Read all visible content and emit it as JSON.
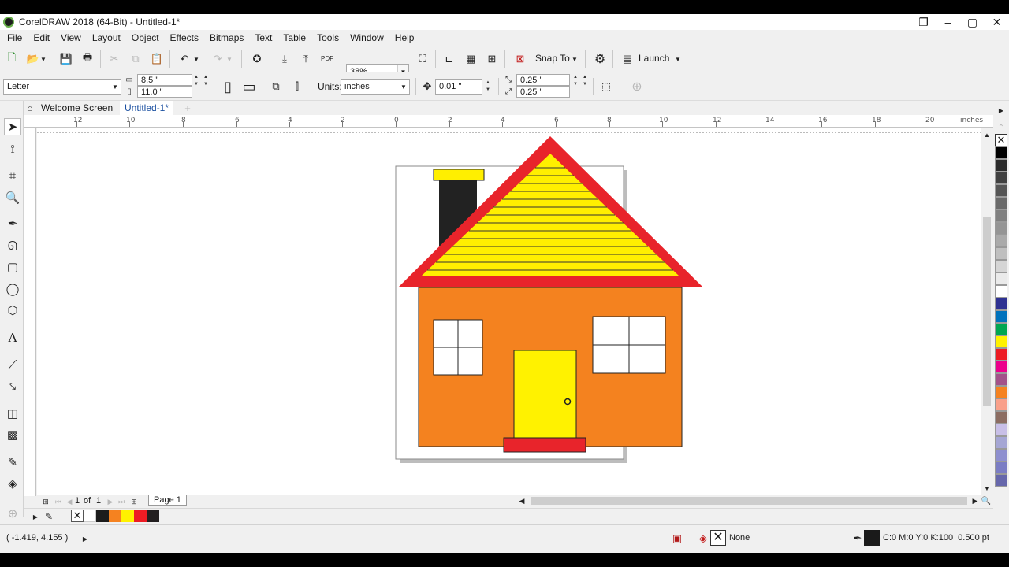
{
  "window": {
    "title": "CorelDRAW 2018 (64-Bit) - Untitled-1*"
  },
  "menu": [
    "File",
    "Edit",
    "View",
    "Layout",
    "Object",
    "Effects",
    "Bitmaps",
    "Text",
    "Table",
    "Tools",
    "Window",
    "Help"
  ],
  "standard_toolbar": {
    "zoom_value": "38%",
    "snap_label": "Snap To",
    "launch_label": "Launch",
    "pdf_label": "PDF"
  },
  "property_bar": {
    "page_size": "Letter",
    "width": "8.5 \"",
    "height": "11.0 \"",
    "units_label": "Units:",
    "units_value": "inches",
    "nudge": "0.01 \"",
    "dup_x": "0.25 \"",
    "dup_y": "0.25 \""
  },
  "tabs": {
    "welcome": "Welcome Screen",
    "doc": "Untitled-1*"
  },
  "ruler": {
    "labels": [
      "12",
      "10",
      "8",
      "6",
      "4",
      "2",
      "0",
      "2",
      "4",
      "6",
      "8",
      "10",
      "12",
      "14",
      "16",
      "18",
      "20"
    ],
    "unit": "inches"
  },
  "page_nav": {
    "current": "1",
    "of_label": "of",
    "total": "1",
    "page_tab": "Page 1"
  },
  "document_palette_colors": [
    "#1c1c1c",
    "#f58220",
    "#fff200",
    "#ed1c24",
    "#231f20"
  ],
  "palette_colors": [
    "#000000",
    "#2b2b2b",
    "#404040",
    "#555555",
    "#6a6a6a",
    "#808080",
    "#959595",
    "#aaaaaa",
    "#bfbfbf",
    "#d5d5d5",
    "#eaeaea",
    "#ffffff",
    "#2e3192",
    "#0072bc",
    "#00a651",
    "#fff200",
    "#ed1c24",
    "#ec008c",
    "#a3518a",
    "#f58220",
    "#f9a08a",
    "#8c6d62",
    "#c8bfe7",
    "#a5a6d4",
    "#8e8fcf",
    "#7b7dc4",
    "#6667ab"
  ],
  "house_colors": {
    "wall": "#f4821f",
    "roof": "#ffef00",
    "roof_trim": "#e8242b",
    "chimney": "#222222",
    "chimney_cap": "#ffef00",
    "door": "#fff200",
    "step": "#e8242b",
    "window": "#ffffff"
  },
  "status": {
    "cursor_pos": "( -1.419, 4.155 )",
    "fill_label": "None",
    "outline_info": "C:0 M:0 Y:0 K:100  0.500 pt"
  }
}
